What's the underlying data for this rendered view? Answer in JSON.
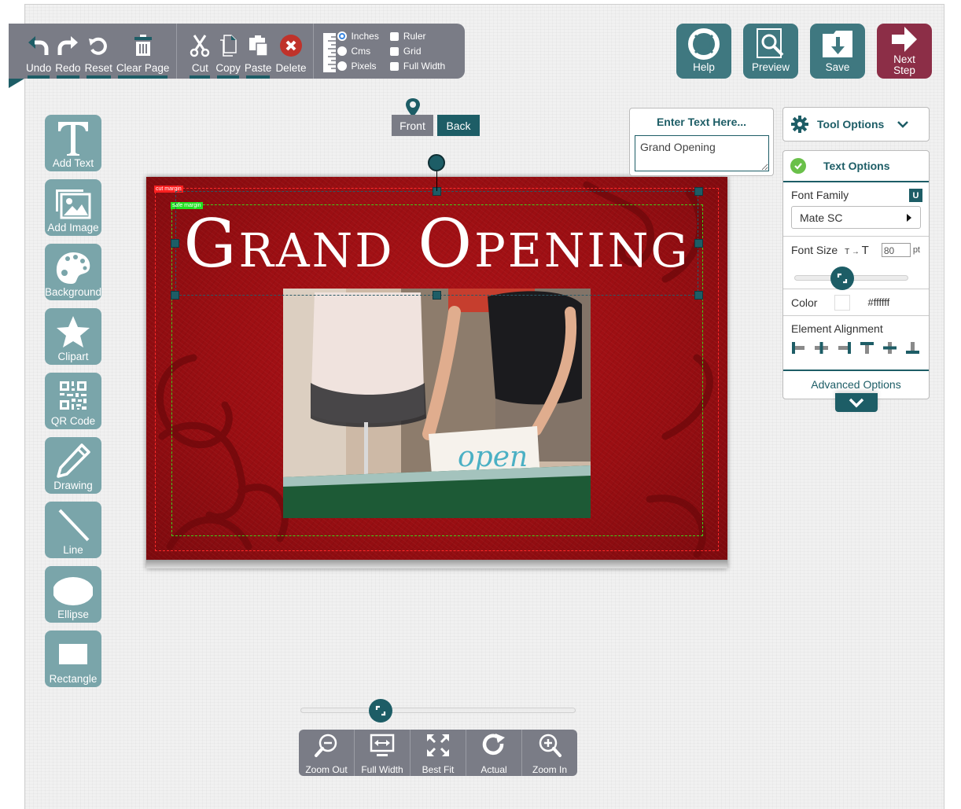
{
  "colors": {
    "teal_dark": "#1d5d66",
    "teal_button": "#3f7880",
    "tool_button": "#7aa5aa",
    "toolbar_gray": "#7a7c86",
    "next_step": "#8c2e47",
    "cut_margin": "#ff2a2a",
    "safe_margin": "#3fd21a",
    "canvas_red": "#a50f14",
    "success_green": "#6ac04a"
  },
  "edit_toolbar": {
    "history": [
      {
        "label": "Undo",
        "icon": "undo-icon"
      },
      {
        "label": "Redo",
        "icon": "redo-icon"
      },
      {
        "label": "Reset",
        "icon": "reset-icon"
      },
      {
        "label": "Clear Page",
        "icon": "trash-icon"
      }
    ],
    "clipboard": [
      {
        "label": "Cut",
        "icon": "scissors-icon"
      },
      {
        "label": "Copy",
        "icon": "copy-icon"
      },
      {
        "label": "Paste",
        "icon": "paste-icon"
      },
      {
        "label": "Delete",
        "icon": "delete-icon"
      }
    ],
    "units": {
      "options": [
        "Inches",
        "Cms",
        "Pixels"
      ],
      "selected": "Inches"
    },
    "view_options": [
      {
        "label": "Ruler",
        "checked": false
      },
      {
        "label": "Grid",
        "checked": false
      },
      {
        "label": "Full Width",
        "checked": false
      }
    ]
  },
  "actions": {
    "help": "Help",
    "preview": "Preview",
    "save": "Save",
    "next_step_line1": "Next",
    "next_step_line2": "Step"
  },
  "tools": [
    {
      "label": "Add Text",
      "icon": "text-icon"
    },
    {
      "label": "Add Image",
      "icon": "image-icon"
    },
    {
      "label": "Background",
      "icon": "palette-icon"
    },
    {
      "label": "Clipart",
      "icon": "star-icon"
    },
    {
      "label": "QR Code",
      "icon": "qr-code-icon"
    },
    {
      "label": "Drawing",
      "icon": "pencil-icon"
    },
    {
      "label": "Line",
      "icon": "line-icon"
    },
    {
      "label": "Ellipse",
      "icon": "ellipse-icon"
    },
    {
      "label": "Rectangle",
      "icon": "rectangle-icon"
    }
  ],
  "sides": {
    "front": "Front",
    "back": "Back",
    "active": "Back"
  },
  "canvas": {
    "headline": "Grand Opening",
    "cut_margin_label": "cut margin",
    "safe_margin_label": "safe margin",
    "photo_sign_text": "open"
  },
  "text_entry": {
    "title": "Enter Text Here...",
    "value": "Grand Opening"
  },
  "tool_options": {
    "title": "Tool Options",
    "text_options_title": "Text Options",
    "font_family_label": "Font Family",
    "font_family_badge": "U",
    "font_family_value": "Mate SC",
    "font_size_label": "Font Size",
    "font_size_small_t": "T",
    "font_size_arrow": "→",
    "font_size_big_t": "T",
    "font_size_value": "80",
    "font_size_unit": "pt",
    "font_size_slider_fraction": 0.42,
    "color_label": "Color",
    "color_value": "#ffffff",
    "alignment_label": "Element Alignment",
    "alignment_buttons": [
      "align-left",
      "align-center-horizontal",
      "align-right",
      "align-top",
      "align-center-vertical",
      "align-bottom"
    ],
    "advanced_label": "Advanced Options"
  },
  "zoom": {
    "slider_fraction": 0.29,
    "buttons": [
      {
        "label": "Zoom Out",
        "icon": "zoom-out-icon"
      },
      {
        "label": "Full Width",
        "icon": "full-width-icon"
      },
      {
        "label": "Best Fit",
        "icon": "best-fit-icon"
      },
      {
        "label": "Actual",
        "icon": "actual-size-icon"
      },
      {
        "label": "Zoom In",
        "icon": "zoom-in-icon"
      }
    ]
  }
}
